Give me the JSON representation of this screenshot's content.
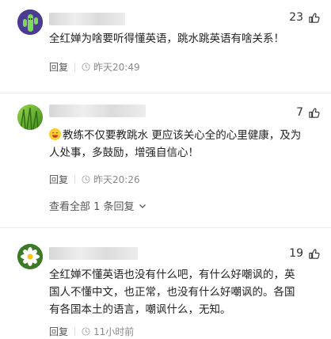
{
  "comments": [
    {
      "likes": "23",
      "text_lines": [
        "全红婵为啥要听得懂英语，跳水跳英语有啥关系！"
      ],
      "reply_label": "回复",
      "time": "昨天20:49",
      "avatar": "green-cactus-avatar"
    },
    {
      "likes": "7",
      "text_lines": [
        "教练不仅要教跳水 更应该关心全的心里健康，及为",
        "人处事，多鼓励，增强自信心！"
      ],
      "reply_label": "回复",
      "time": "昨天20:26",
      "avatar": "green-grass-avatar",
      "emoji": "grinning-face-emoji",
      "view_more": "查看全部 1 条回复"
    },
    {
      "likes": "19",
      "text_lines": [
        "全红婵不懂英语也没有什么吧，有什么好嘲讽的，英",
        "国人不懂中文，也正常，也没有什么好嘲讽的。各国",
        "有各国本土的语言，嘲讽什么，无知。"
      ],
      "reply_label": "回复",
      "time": "11小时前",
      "avatar": "white-flower-avatar"
    }
  ],
  "icons": {
    "like": "thumbs-up-icon",
    "clock": "clock-icon",
    "chevron": "chevron-down-icon"
  }
}
